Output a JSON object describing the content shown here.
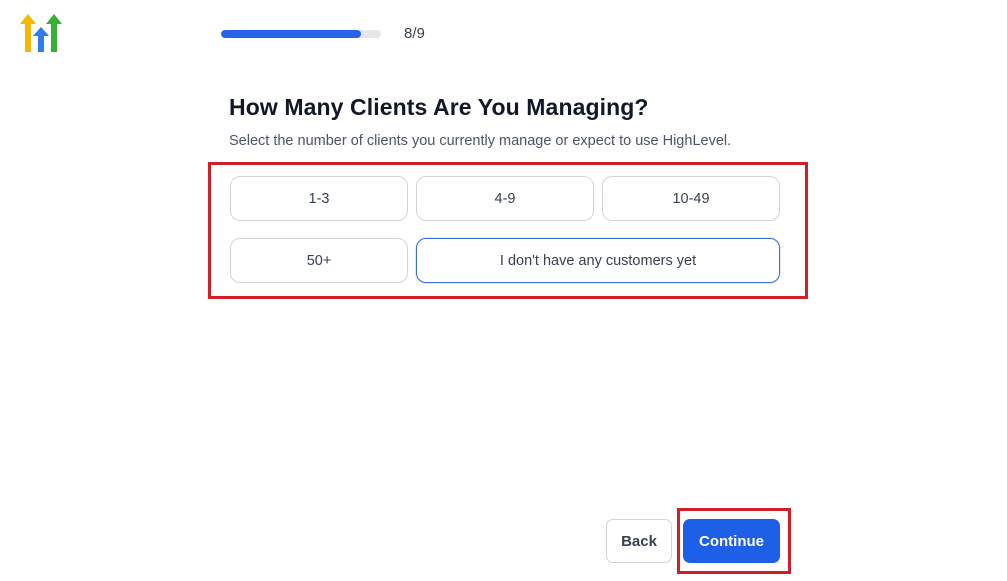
{
  "brand": {
    "logo_icon": "highlevel-arrows-logo-icon",
    "colors": {
      "yellow": "#f5b800",
      "blue": "#2d7df0",
      "green": "#34b233"
    }
  },
  "progress": {
    "label": "8/9",
    "fraction": 0.875,
    "color": "#2563eb"
  },
  "question": {
    "title": "How Many Clients Are You Managing?",
    "subtitle": "Select the number of clients you currently manage or expect to use HighLevel."
  },
  "options": [
    {
      "label": "1-3",
      "selected": false
    },
    {
      "label": "4-9",
      "selected": false
    },
    {
      "label": "10-49",
      "selected": false
    },
    {
      "label": "50+",
      "selected": false
    },
    {
      "label": "I don't have any customers yet",
      "selected": true
    }
  ],
  "footer": {
    "back_label": "Back",
    "continue_label": "Continue",
    "accent_color": "#1e5fe8"
  },
  "annotations": {
    "highlight_color": "#d01f26"
  }
}
